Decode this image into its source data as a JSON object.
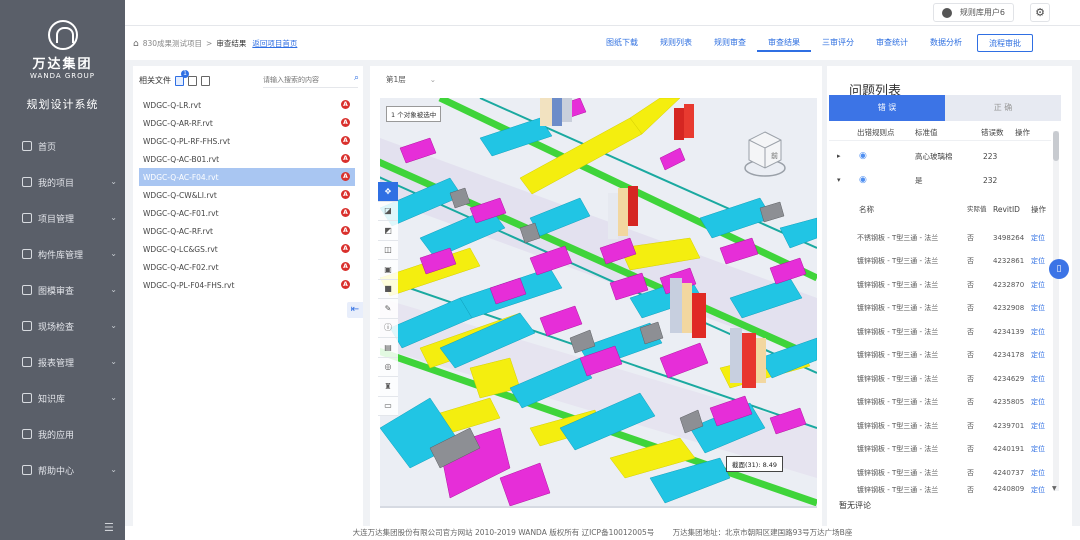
{
  "brand": {
    "name_cn": "万达集团",
    "name_en": "WANDA GROUP",
    "system_name": "规划设计系统"
  },
  "sidebar": {
    "items": [
      {
        "label": "首页",
        "icon": "home-icon",
        "has_children": false
      },
      {
        "label": "我的项目",
        "icon": "project-icon",
        "has_children": true
      },
      {
        "label": "项目管理",
        "icon": "project-manage-icon",
        "has_children": true
      },
      {
        "label": "构件库管理",
        "icon": "component-library-icon",
        "has_children": true
      },
      {
        "label": "图模审查",
        "icon": "model-review-icon",
        "has_children": true
      },
      {
        "label": "现场检查",
        "icon": "site-inspection-icon",
        "has_children": true
      },
      {
        "label": "报表管理",
        "icon": "report-icon",
        "has_children": true
      },
      {
        "label": "知识库",
        "icon": "knowledge-icon",
        "has_children": true
      },
      {
        "label": "我的应用",
        "icon": "app-icon",
        "has_children": false
      },
      {
        "label": "帮助中心",
        "icon": "help-icon",
        "has_children": true
      }
    ],
    "chevron": "⌄",
    "toggle_glyph": "☰"
  },
  "topbar": {
    "user_name": "规则库用户6",
    "gear_glyph": "⚙"
  },
  "breadcrumb": {
    "home_glyph": "⌂",
    "project": "830成果测试项目",
    "separator": ">",
    "current": "审查结果",
    "back_link": "返回项目首页"
  },
  "nav": {
    "links": [
      {
        "label": "图纸下载",
        "active": false
      },
      {
        "label": "规则列表",
        "active": false
      },
      {
        "label": "规则审查",
        "active": false
      },
      {
        "label": "审查结果",
        "active": true
      },
      {
        "label": "三审评分",
        "active": false
      },
      {
        "label": "审查统计",
        "active": false
      },
      {
        "label": "数据分析",
        "active": false
      }
    ],
    "workflow_button": "流程审批"
  },
  "files": {
    "title": "相关文件",
    "badge": "1",
    "search_placeholder": "请输入搜索的内容",
    "search_glyph": "⌕",
    "error_glyph": "A",
    "collapse_glyph": "⇤",
    "items": [
      {
        "name": "WDGC-Q-LR.rvt",
        "selected": false
      },
      {
        "name": "WDGC-Q-AR-RF.rvt",
        "selected": false
      },
      {
        "name": "WDGC-Q-PL-RF-FHS.rvt",
        "selected": false
      },
      {
        "name": "WDGC-Q-AC-B01.rvt",
        "selected": false
      },
      {
        "name": "WDGC-Q-AC-F04.rvt",
        "selected": true
      },
      {
        "name": "WDGC-Q-CW&LI.rvt",
        "selected": false
      },
      {
        "name": "WDGC-Q-AC-F01.rvt",
        "selected": false
      },
      {
        "name": "WDGC-Q-AC-RF.rvt",
        "selected": false
      },
      {
        "name": "WDGC-Q-LC&GS.rvt",
        "selected": false
      },
      {
        "name": "WDGC-Q-AC-F02.rvt",
        "selected": false
      },
      {
        "name": "WDGC-Q-PL-F04-FHS.rvt",
        "selected": false
      }
    ]
  },
  "viewer": {
    "floor": "第1层",
    "floor_arrow": "⌄",
    "selection_tip": "1 个对象被选中",
    "measure_tip": "截面(31): 8.49",
    "cube_label": "前",
    "tools": [
      {
        "glyph": "✥",
        "active": true
      },
      {
        "glyph": "◪",
        "active": false
      },
      {
        "glyph": "◩",
        "active": false
      },
      {
        "glyph": "◫",
        "active": false
      },
      {
        "glyph": "▣",
        "active": false
      },
      {
        "glyph": "■",
        "active": false
      },
      {
        "glyph": "✎",
        "active": false
      },
      {
        "glyph": "ⓘ",
        "active": false
      },
      {
        "glyph": "▤",
        "active": false
      },
      {
        "glyph": "◎",
        "active": false
      },
      {
        "glyph": "♜",
        "active": false
      },
      {
        "glyph": "▭",
        "active": false
      }
    ]
  },
  "issues": {
    "title": "问题列表",
    "tabs": [
      {
        "label": "错 误",
        "active": true
      },
      {
        "label": "正 确",
        "active": false
      }
    ],
    "header": {
      "col1": "出错规则点",
      "col2": "标准值",
      "col3": "错误数",
      "col4": "操作"
    },
    "groups": [
      {
        "expand_glyph": "▸",
        "eye_glyph": "◉",
        "standard": "高心玻璃棉",
        "count": "223"
      },
      {
        "expand_glyph": "▾",
        "eye_glyph": "◉",
        "standard": "是",
        "count": "232"
      }
    ],
    "detail_header": {
      "name": "名称",
      "actual": "实际值",
      "revit_id": "RevitID",
      "action": "操作"
    },
    "rows": [
      {
        "name": "不锈钢板 - T型三通 - 法兰",
        "actual": "否",
        "id": "3498264",
        "action": "定位"
      },
      {
        "name": "镀锌钢板 - T型三通 - 法兰",
        "actual": "否",
        "id": "4232861",
        "action": "定位"
      },
      {
        "name": "镀锌钢板 - T型三通 - 法兰",
        "actual": "否",
        "id": "4232870",
        "action": "定位"
      },
      {
        "name": "镀锌钢板 - T型三通 - 法兰",
        "actual": "否",
        "id": "4232908",
        "action": "定位"
      },
      {
        "name": "镀锌钢板 - T型三通 - 法兰",
        "actual": "否",
        "id": "4234139",
        "action": "定位"
      },
      {
        "name": "镀锌钢板 - T型三通 - 法兰",
        "actual": "否",
        "id": "4234178",
        "action": "定位"
      },
      {
        "name": "镀锌钢板 - T型三通 - 法兰",
        "actual": "否",
        "id": "4234629",
        "action": "定位"
      },
      {
        "name": "镀锌钢板 - T型三通 - 法兰",
        "actual": "否",
        "id": "4235805",
        "action": "定位"
      },
      {
        "name": "镀锌钢板 - T型三通 - 法兰",
        "actual": "否",
        "id": "4239701",
        "action": "定位"
      },
      {
        "name": "镀锌钢板 - T型三通 - 法兰",
        "actual": "否",
        "id": "4240191",
        "action": "定位"
      },
      {
        "name": "镀锌钢板 - T型三通 - 法兰",
        "actual": "否",
        "id": "4240737",
        "action": "定位"
      },
      {
        "name": "镀锌钢板 - T型三通 - 法兰",
        "actual": "否",
        "id": "4240809",
        "action": "定位"
      }
    ],
    "scroll_down_glyph": "▼",
    "no_comment": "暂无评论",
    "float_glyph": "▯"
  },
  "footer": {
    "copyright": "大连万达集团股份有限公司官方网站 2010-2019 WANDA 版权所有 辽ICP备10012005号",
    "address": "万达集团地址：北京市朝阳区建国路93号万达广场B座"
  },
  "colors": {
    "sidebar_bg": "#5a5f69",
    "accent": "#2f6fe3",
    "error_red": "#d9302c",
    "duct_cyan": "#21c5e4",
    "duct_yellow": "#f4ee0f",
    "duct_magenta": "#e62ed8",
    "pipe_green": "#3fd43a",
    "duct_gray": "#8d8f94"
  }
}
